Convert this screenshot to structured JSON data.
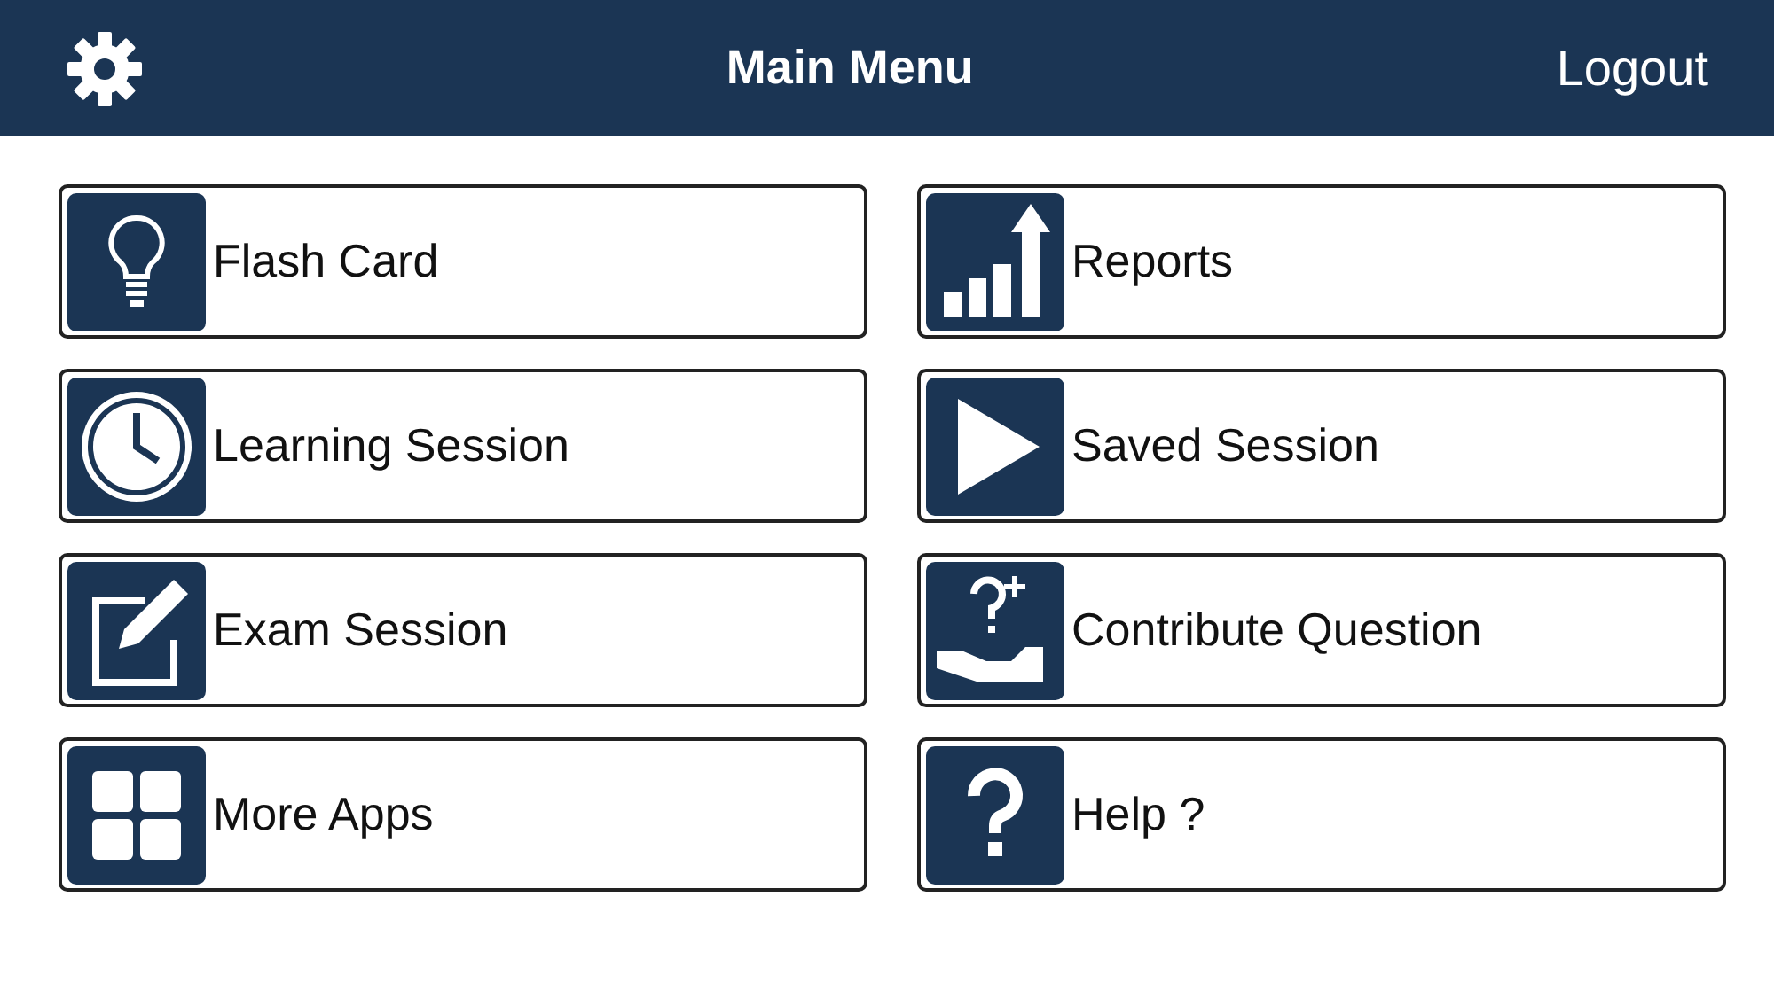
{
  "header": {
    "title": "Main Menu",
    "logout": "Logout"
  },
  "menu": [
    {
      "label": "Flash Card"
    },
    {
      "label": "Reports"
    },
    {
      "label": "Learning Session"
    },
    {
      "label": "Saved Session"
    },
    {
      "label": "Exam Session"
    },
    {
      "label": "Contribute Question"
    },
    {
      "label": "More Apps"
    },
    {
      "label": "Help ?"
    }
  ]
}
